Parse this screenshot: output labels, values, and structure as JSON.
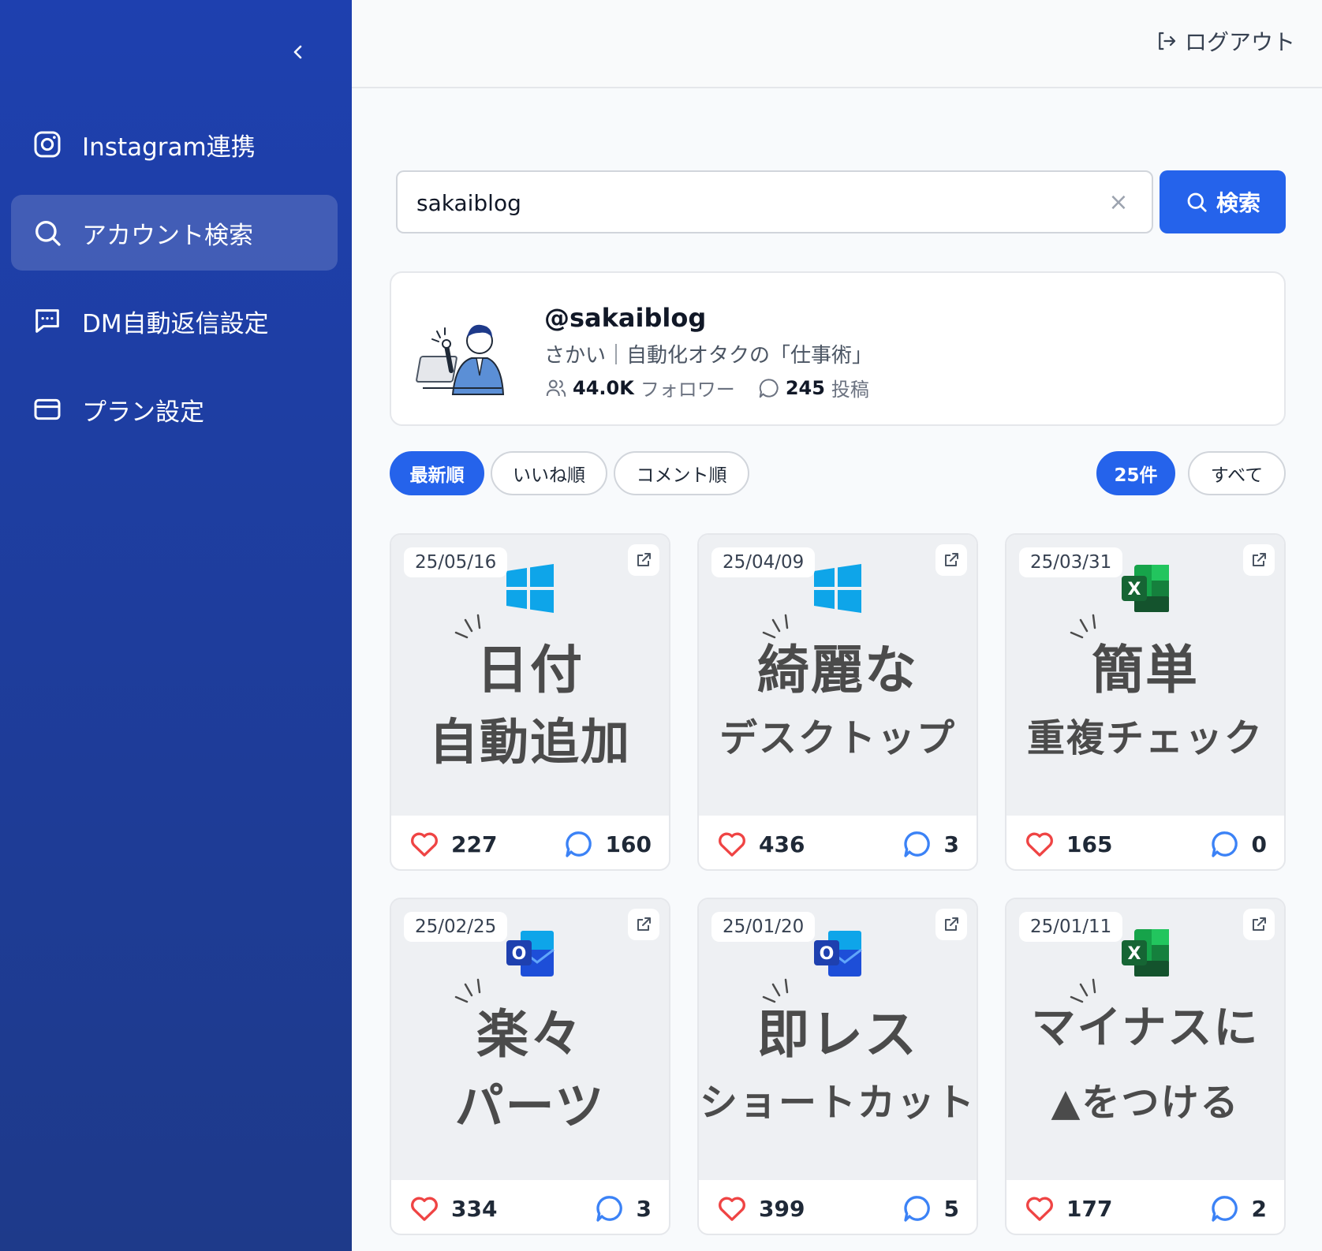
{
  "sidebar": {
    "items": [
      {
        "label": "Instagram連携",
        "icon": "instagram-icon"
      },
      {
        "label": "アカウント検索",
        "icon": "search-icon",
        "active": true
      },
      {
        "label": "DM自動返信設定",
        "icon": "message-icon"
      },
      {
        "label": "プラン設定",
        "icon": "credit-card-icon"
      }
    ]
  },
  "header": {
    "logout_label": "ログアウト"
  },
  "search": {
    "value": "sakaiblog",
    "button_label": "検索",
    "clear_label": "×"
  },
  "profile": {
    "handle": "@sakaiblog",
    "bio": "さかい｜自動化オタクの「仕事術」",
    "followers_value": "44.0K",
    "followers_label": "フォロワー",
    "posts_value": "245",
    "posts_label": "投稿"
  },
  "filters": {
    "sort": [
      "最新順",
      "いいね順",
      "コメント順"
    ],
    "count": [
      "25件",
      "すべて"
    ]
  },
  "posts": [
    {
      "date": "25/05/16",
      "line1": "日付",
      "line2": "自動追加",
      "logo": "windows-icon",
      "likes": "227",
      "comments": "160"
    },
    {
      "date": "25/04/09",
      "line1": "綺麗な",
      "line2": "デスクトップ",
      "logo": "windows-icon",
      "likes": "436",
      "comments": "3"
    },
    {
      "date": "25/03/31",
      "line1": "簡単",
      "line2": "重複チェック",
      "logo": "excel-icon",
      "likes": "165",
      "comments": "0"
    },
    {
      "date": "25/02/25",
      "line1": "楽々",
      "line2": "パーツ",
      "logo": "outlook-icon",
      "likes": "334",
      "comments": "3"
    },
    {
      "date": "25/01/20",
      "line1": "即レス",
      "line2": "ショートカット",
      "logo": "outlook-icon",
      "likes": "399",
      "comments": "5"
    },
    {
      "date": "25/01/11",
      "line1": "マイナスに",
      "line2": "▲をつける",
      "logo": "excel-icon",
      "likes": "177",
      "comments": "2"
    }
  ],
  "colors": {
    "sidebar": "#1e40af",
    "accent": "#2563eb",
    "heart": "#ef4444"
  }
}
